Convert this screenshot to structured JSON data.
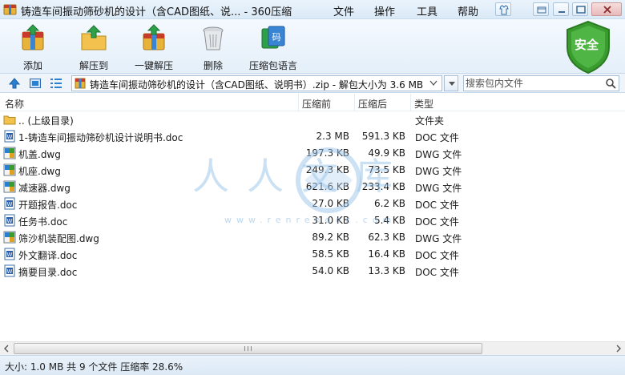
{
  "window": {
    "title": "铸造车间振动筛砂机的设计（含CAD图纸、说... - 360压缩",
    "menu": [
      "文件",
      "操作",
      "工具",
      "帮助"
    ]
  },
  "toolbar": {
    "buttons": [
      {
        "label": "添加",
        "icon": "add-archive-icon"
      },
      {
        "label": "解压到",
        "icon": "extract-to-icon"
      },
      {
        "label": "一键解压",
        "icon": "one-click-extract-icon"
      },
      {
        "label": "删除",
        "icon": "trash-icon"
      },
      {
        "label": "压缩包语言",
        "icon": "archive-language-icon"
      }
    ],
    "security_label": "安全"
  },
  "addressbar": {
    "path": "铸造车间振动筛砂机的设计（含CAD图纸、说明书）.zip - 解包大小为 3.6 MB",
    "search_placeholder": "搜索包内文件"
  },
  "list": {
    "columns": {
      "name": "名称",
      "compressed": "压缩前",
      "size": "压缩后",
      "type": "类型"
    },
    "rows": [
      {
        "name": ".. (上级目录)",
        "compressed": "",
        "size": "",
        "type": "文件夹",
        "icon": "folder-icon"
      },
      {
        "name": "1-铸造车间振动筛砂机设计说明书.doc",
        "compressed": "2.3 MB",
        "size": "591.3 KB",
        "type": "DOC 文件",
        "icon": "doc-file-icon"
      },
      {
        "name": "机盖.dwg",
        "compressed": "197.3 KB",
        "size": "49.9 KB",
        "type": "DWG 文件",
        "icon": "dwg-file-icon"
      },
      {
        "name": "机座.dwg",
        "compressed": "249.3 KB",
        "size": "73.5 KB",
        "type": "DWG 文件",
        "icon": "dwg-file-icon"
      },
      {
        "name": "减速器.dwg",
        "compressed": "621.6 KB",
        "size": "233.4 KB",
        "type": "DWG 文件",
        "icon": "dwg-file-icon"
      },
      {
        "name": "开题报告.doc",
        "compressed": "27.0 KB",
        "size": "6.2 KB",
        "type": "DOC 文件",
        "icon": "doc-file-icon"
      },
      {
        "name": "任务书.doc",
        "compressed": "31.0 KB",
        "size": "5.4 KB",
        "type": "DOC 文件",
        "icon": "doc-file-icon"
      },
      {
        "name": "筛沙机装配图.dwg",
        "compressed": "89.2 KB",
        "size": "62.3 KB",
        "type": "DWG 文件",
        "icon": "dwg-file-icon"
      },
      {
        "name": "外文翻译.doc",
        "compressed": "58.5 KB",
        "size": "16.4 KB",
        "type": "DOC 文件",
        "icon": "doc-file-icon"
      },
      {
        "name": "摘要目录.doc",
        "compressed": "54.0 KB",
        "size": "13.3 KB",
        "type": "DOC 文件",
        "icon": "doc-file-icon"
      }
    ]
  },
  "watermark": {
    "text": "人人文库",
    "url": "www.renrendoc.com"
  },
  "status": {
    "text": "大小: 1.0 MB 共 9 个文件 压缩率 28.6%"
  },
  "colors": {
    "accent": "#2a6db5",
    "security_green": "#3a9b2f",
    "selection": "#cfe3f8"
  }
}
